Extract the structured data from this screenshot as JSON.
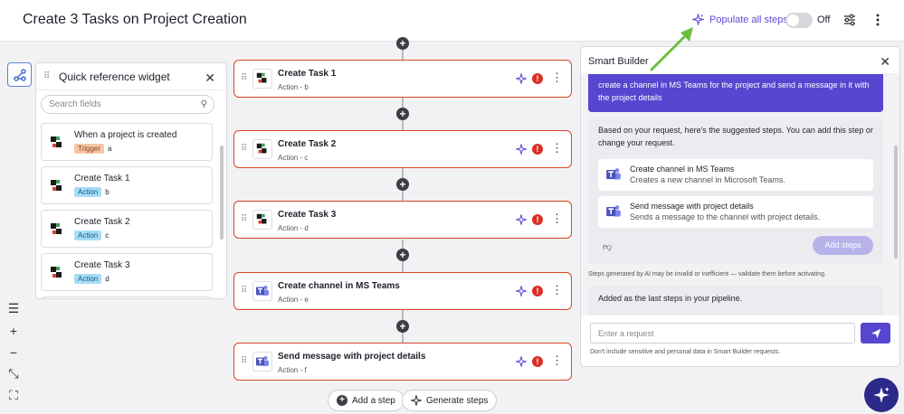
{
  "header": {
    "title": "Create 3 Tasks on Project Creation",
    "populate_label": "Populate all steps",
    "toggle_label": "Off"
  },
  "widget": {
    "title": "Quick reference widget",
    "search_placeholder": "Search fields",
    "items": [
      {
        "name": "When a project is created",
        "badge": "Trigger",
        "letter": "a"
      },
      {
        "name": "Create Task 1",
        "badge": "Action",
        "letter": "b"
      },
      {
        "name": "Create Task 2",
        "badge": "Action",
        "letter": "c"
      },
      {
        "name": "Create Task 3",
        "badge": "Action",
        "letter": "d"
      }
    ]
  },
  "steps": [
    {
      "name": "Create Task 1",
      "sub": "Action - b",
      "app": "project-app"
    },
    {
      "name": "Create Task 2",
      "sub": "Action - c",
      "app": "project-app"
    },
    {
      "name": "Create Task 3",
      "sub": "Action - d",
      "app": "project-app"
    },
    {
      "name": "Create channel in MS Teams",
      "sub": "Action - e",
      "app": "teams"
    },
    {
      "name": "Send message with project details",
      "sub": "Action - f",
      "app": "teams"
    }
  ],
  "bottom": {
    "add_step": "Add a step",
    "generate_steps": "Generate steps"
  },
  "smart_builder": {
    "title": "Smart Builder",
    "user_message": "create a channel in MS Teams for the project and send a message in it with the project details",
    "bot_message": "Based on your request, here's the suggested steps. You can add this step or change your request.",
    "suggestions": [
      {
        "name": "Create channel in MS Teams",
        "desc": "Creates a new channel in Microsoft Teams."
      },
      {
        "name": "Send message with project details",
        "desc": "Sends a message to the channel with project details."
      }
    ],
    "add_steps_label": "Add steps",
    "disclaimer": "Steps generated by AI may be invalid or inefficient — validate them before activating.",
    "bot_message_2": "Added as the last steps in your pipeline.",
    "input_placeholder": "Enter a request",
    "note": "Don't include sensitive and personal data in Smart Builder requests."
  },
  "colors": {
    "accent": "#5746cf",
    "error_border": "#d64524",
    "annotation_arrow": "#6fbf3f"
  }
}
